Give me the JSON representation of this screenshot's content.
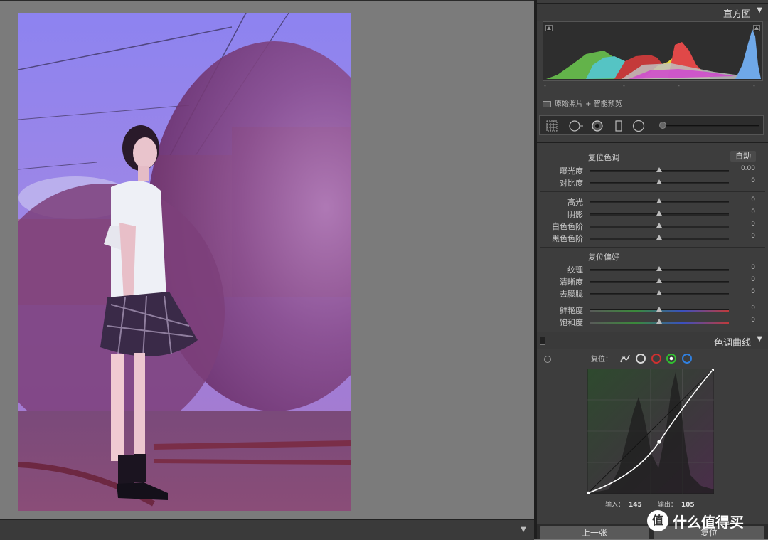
{
  "histogram": {
    "title": "直方图",
    "original_photo_label": "原始照片 + 智能预览",
    "tick_marks": [
      "-",
      "-",
      "-",
      "-"
    ]
  },
  "basic": {
    "tone_group_title": "复位色调",
    "auto_label": "自动",
    "presence_group_title": "复位偏好",
    "sliders": [
      {
        "label": "曝光度",
        "value": "0.00"
      },
      {
        "label": "对比度",
        "value": "0"
      },
      {
        "label": "高光",
        "value": "0"
      },
      {
        "label": "阴影",
        "value": "0"
      },
      {
        "label": "白色色阶",
        "value": "0"
      },
      {
        "label": "黑色色阶",
        "value": "0"
      },
      {
        "label": "纹理",
        "value": "0"
      },
      {
        "label": "清晰度",
        "value": "0"
      },
      {
        "label": "去朦胧",
        "value": "0"
      },
      {
        "label": "鲜艳度",
        "value": "0"
      },
      {
        "label": "饱和度",
        "value": "0"
      }
    ]
  },
  "tone_curve": {
    "title": "色调曲线",
    "reset_label": "复位：",
    "input_label": "输入：",
    "input_value": "145",
    "output_label": "输出：",
    "output_value": "105",
    "channels": [
      {
        "name": "parametric-icon",
        "color": "#d8d8d8"
      },
      {
        "name": "rgb-channel",
        "color": "#d8d8d8"
      },
      {
        "name": "red-channel",
        "color": "#d03030"
      },
      {
        "name": "green-channel",
        "color": "#30c030"
      },
      {
        "name": "blue-channel",
        "color": "#3080e0"
      }
    ]
  },
  "bottom": {
    "previous_label": "上一张",
    "reset_label": "复位"
  },
  "watermark": {
    "logo_char": "值",
    "text": "什么值得买"
  }
}
